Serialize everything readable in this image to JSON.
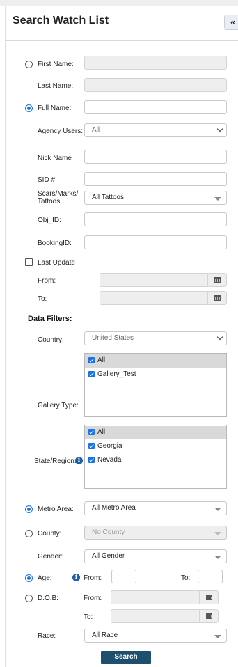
{
  "header": {
    "title": "Search Watch List",
    "collapse_icon": "«"
  },
  "fields": {
    "first_name": "First Name:",
    "last_name": "Last Name:",
    "full_name": "Full Name:",
    "agency_users": "Agency Users:",
    "agency_users_value": "All",
    "nick_name": "Nick Name",
    "sid": "SID #",
    "scars": "Scars/Marks/ Tattoos",
    "scars_value": "All Tattoos",
    "obj_id": "Obj_ID:",
    "booking_id": "BookingID:",
    "last_update": "Last Update",
    "from": "From:",
    "to": "To:"
  },
  "data_filters": {
    "heading": "Data Filters:",
    "country": "Country:",
    "country_value": "United States",
    "gallery_type": "Gallery Type:",
    "gallery_items": [
      "All",
      "Gallery_Test"
    ],
    "state_region": "State/Region:",
    "state_items": [
      "All",
      "Georgia",
      "Nevada"
    ],
    "metro_area": "Metro Area:",
    "metro_value": "All Metro Area",
    "county": "County:",
    "county_value": "No County",
    "gender": "Gender:",
    "gender_value": "All Gender",
    "age": "Age:",
    "age_from": "From:",
    "age_to": "To:",
    "dob": "D.O.B:",
    "dob_from": "From:",
    "dob_to": "To:",
    "race": "Race:",
    "race_value": "All Race"
  },
  "search_label": "Search",
  "colors": {
    "accent": "#1a73e8",
    "button": "#1e4f6f",
    "info": "#1f5fa8"
  }
}
